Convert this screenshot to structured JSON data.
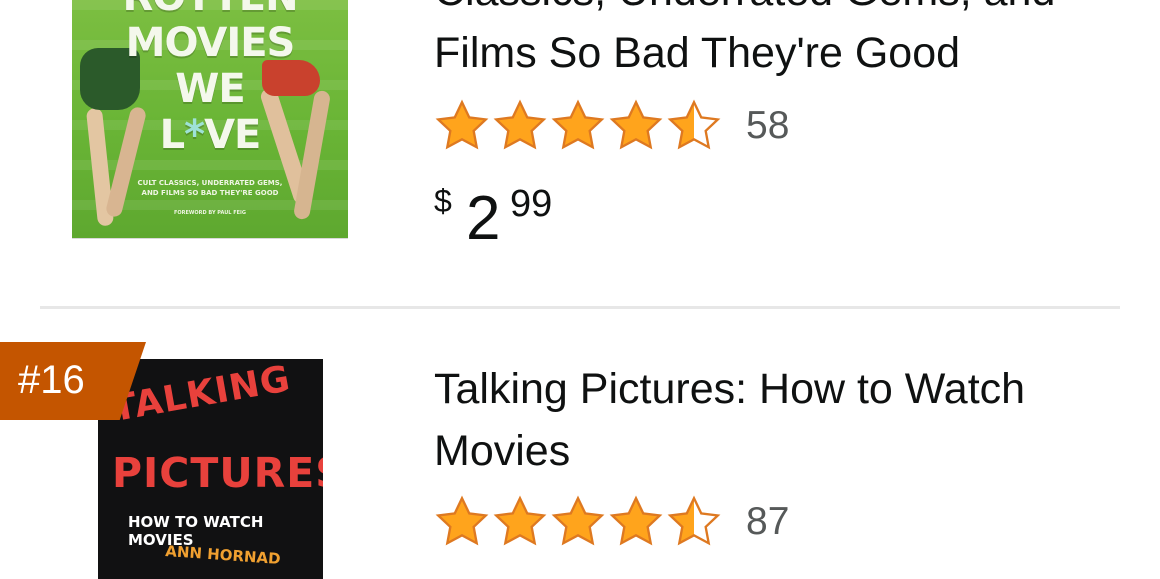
{
  "items": [
    {
      "title": "Classics, Underrated Gems, and\nFilms So Bad They're Good",
      "rating_value": 4.5,
      "rating_count": "58",
      "price": {
        "symbol": "$",
        "whole": "2",
        "fraction": "99"
      },
      "cover": {
        "title_lines": [
          "ROTTEN",
          "MOVIES",
          "WE",
          "L*VE"
        ],
        "subtitle": "CULT CLASSICS, UNDERRATED GEMS,\nAND FILMS SO BAD THEY'RE GOOD",
        "foreword": "FOREWORD BY PAUL FEIG"
      }
    },
    {
      "rank": "#16",
      "title": "Talking Pictures: How to Watch\nMovies",
      "rating_value": 4.5,
      "rating_count": "87",
      "cover": {
        "line1": "TALKING",
        "line2": "PICTURES",
        "line3": "HOW TO WATCH MOVIES",
        "author": "ANN HORNAD"
      }
    }
  ],
  "colors": {
    "star": "#ffa41c",
    "star_outline": "#de7921",
    "rank_badge": "#c45500",
    "divider": "#e7e7e7"
  }
}
